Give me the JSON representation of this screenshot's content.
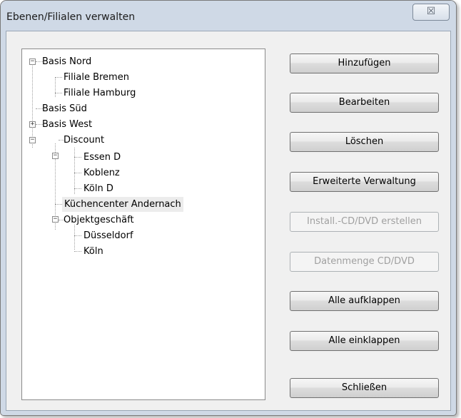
{
  "window": {
    "title": "Ebenen/Filialen verwalten",
    "close_glyph": "☒"
  },
  "tree": {
    "nodes": [
      {
        "label": "Basis Nord",
        "expander": "−"
      },
      {
        "label": "Filiale Bremen"
      },
      {
        "label": "Filiale Hamburg"
      },
      {
        "label": "Basis Süd",
        "expander": "+"
      },
      {
        "label": "Basis West",
        "expander": "−"
      },
      {
        "label": "Discount",
        "expander": "−"
      },
      {
        "label": "Essen D"
      },
      {
        "label": "Koblenz"
      },
      {
        "label": "Köln D"
      },
      {
        "label": "Küchencenter Andernach",
        "selected": true
      },
      {
        "label": "Objektgeschäft",
        "expander": "−"
      },
      {
        "label": "Düsseldorf"
      },
      {
        "label": "Köln"
      }
    ]
  },
  "buttons": [
    {
      "label": "Hinzufügen",
      "enabled": true
    },
    {
      "label": "Bearbeiten",
      "enabled": true
    },
    {
      "label": "Löschen",
      "enabled": true
    },
    {
      "label": "Erweiterte Verwaltung",
      "enabled": true
    },
    {
      "label": "Install.-CD/DVD erstellen",
      "enabled": false
    },
    {
      "label": "Datenmenge CD/DVD",
      "enabled": false
    },
    {
      "label": "Alle aufklappen",
      "enabled": true
    },
    {
      "label": "Alle einklappen",
      "enabled": true
    },
    {
      "label": "Schließen",
      "enabled": true
    }
  ],
  "colors": {
    "frame": "#cfd9e6",
    "client": "#f0f0f0",
    "disabled_text": "#a0a0a0"
  }
}
